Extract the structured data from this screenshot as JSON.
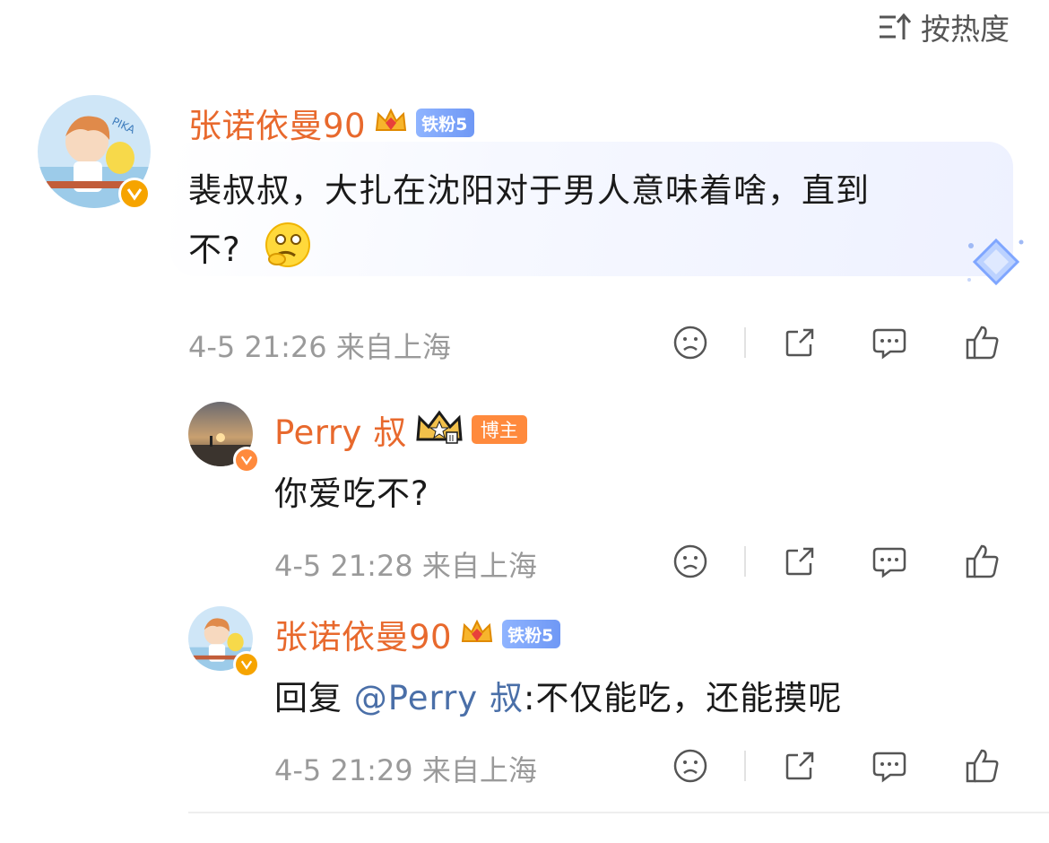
{
  "sort": {
    "label": "按热度",
    "icon": "sort-icon"
  },
  "comments": [
    {
      "user": "张诺依曼90",
      "badge": "铁粉5",
      "text": "裴叔叔，大扎在沈阳对于男人意味着啥，直到",
      "text_line2": "不?",
      "emoji": "thinking-face-emoji",
      "meta": "4-5 21:26 来自上海",
      "avatar": "anime-avatar"
    },
    {
      "user": "Perry 叔",
      "badge": "博主",
      "text": "你爱吃不?",
      "meta": "4-5 21:28 来自上海",
      "avatar": "sunset-avatar"
    },
    {
      "user": "张诺依曼90",
      "badge": "铁粉5",
      "reply_prefix": "回复 ",
      "mention": "@Perry 叔",
      "text": ":不仅能吃，还能摸呢",
      "meta": "4-5 21:29 来自上海",
      "avatar": "anime-avatar"
    }
  ],
  "colors": {
    "name": "#e8692d",
    "mention": "#4a6fa8",
    "meta": "#9a9a9a",
    "fan_badge": "#7aa2f7",
    "host_badge": "#ff8a3d",
    "verified": "#f6a400"
  }
}
